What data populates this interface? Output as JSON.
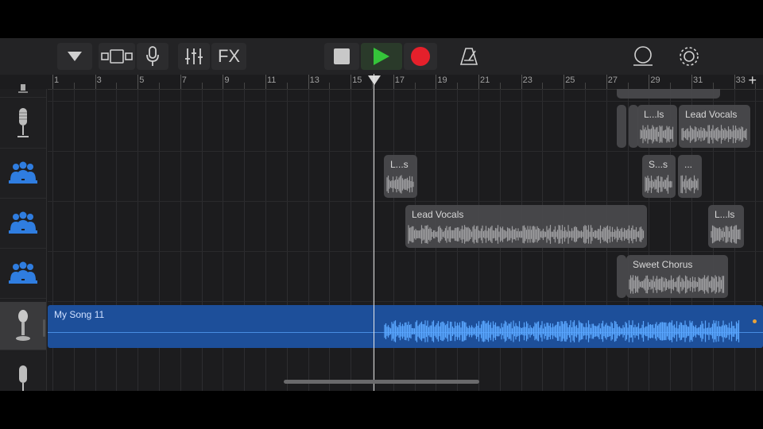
{
  "toolbar": {
    "buttons": [
      {
        "name": "browser-dropdown-button",
        "icon": "triangle-down-icon"
      },
      {
        "name": "view-toggle-button",
        "icon": "tracks-view-icon"
      },
      {
        "name": "microphone-button",
        "icon": "microphone-icon"
      },
      {
        "name": "mixer-button",
        "icon": "sliders-icon"
      },
      {
        "name": "fx-button",
        "label": "FX"
      },
      {
        "name": "stop-button",
        "icon": "stop-icon"
      },
      {
        "name": "play-button",
        "icon": "play-icon",
        "color": "#35c43a"
      },
      {
        "name": "record-button",
        "icon": "record-icon",
        "color": "#e5202b"
      },
      {
        "name": "metronome-button",
        "icon": "metronome-icon"
      },
      {
        "name": "loop-button",
        "icon": "loop-icon"
      },
      {
        "name": "settings-button",
        "icon": "gear-icon"
      }
    ]
  },
  "ruler": {
    "numbers": [
      "1",
      "3",
      "5",
      "7",
      "9",
      "11",
      "13",
      "15",
      "17",
      "19",
      "21",
      "23",
      "25",
      "27",
      "29",
      "31",
      "33"
    ],
    "add_label": "+"
  },
  "tracks": [
    {
      "icon": "microphone-icon",
      "type": "partial"
    },
    {
      "icon": "microphone-icon",
      "regions": [
        {
          "label": ""
        },
        {
          "label": "L...ls"
        },
        {
          "label": "Lead Vocals"
        }
      ]
    },
    {
      "icon": "choir-icon",
      "regions": [
        {
          "label": "L...s"
        },
        {
          "label": "S...s"
        },
        {
          "label": "..."
        }
      ]
    },
    {
      "icon": "choir-icon",
      "regions": [
        {
          "label": "Lead Vocals"
        },
        {
          "label": "L...ls"
        }
      ]
    },
    {
      "icon": "choir-icon",
      "regions": [
        {
          "label": ""
        },
        {
          "label": "Sweet Chorus"
        }
      ]
    },
    {
      "icon": "vintage-microphone-icon",
      "selected": true,
      "regions": [
        {
          "label": "My Song 11",
          "color": "#1d4f9a"
        }
      ]
    },
    {
      "icon": "microphone-icon",
      "type": "partial"
    }
  ],
  "colors": {
    "accent_blue": "#1d4f9a",
    "waveform_blue": "#5aa7ff",
    "region_gray": "#4a4a4d"
  }
}
